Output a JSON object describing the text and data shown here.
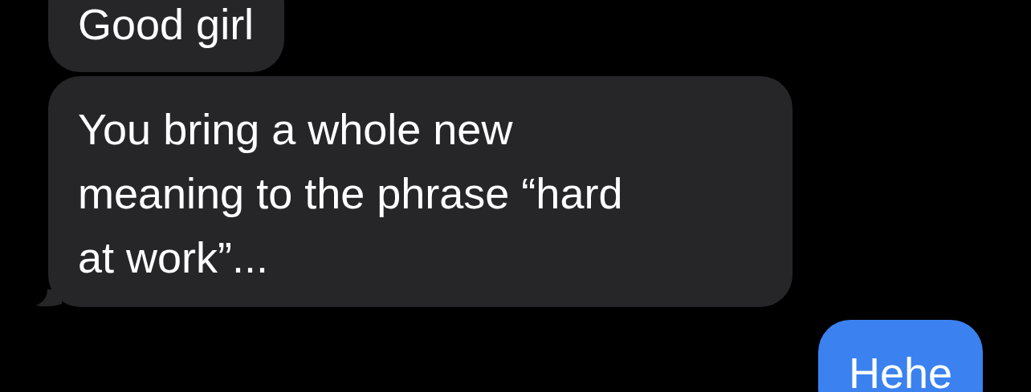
{
  "messages": [
    {
      "kind": "received",
      "text": "Good girl",
      "tail": false
    },
    {
      "kind": "received",
      "text": "You bring a whole new\nmeaning to the phrase “hard\nat work”...",
      "tail": true
    },
    {
      "kind": "sent",
      "text": "Hehe",
      "tail": false
    }
  ]
}
